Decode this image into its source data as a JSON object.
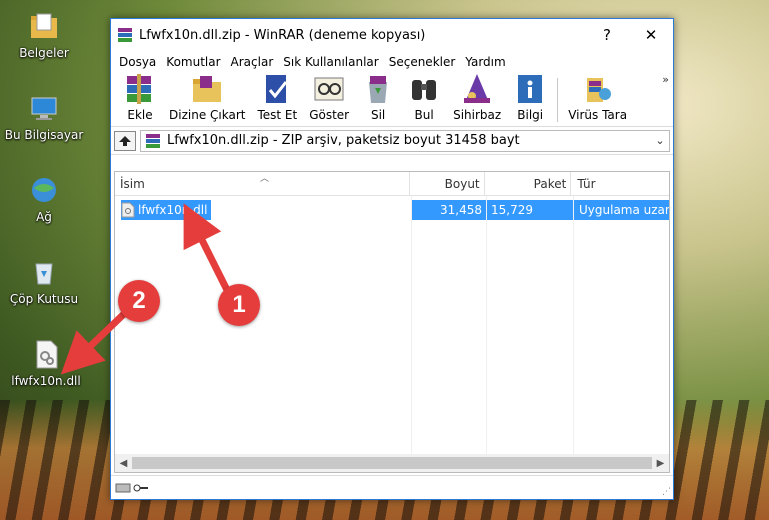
{
  "desktop": {
    "icons": [
      {
        "label": "Belgeler",
        "icon": "folder-documents-icon"
      },
      {
        "label": "Bu Bilgisayar",
        "icon": "computer-icon"
      },
      {
        "label": "Ağ",
        "icon": "network-icon"
      },
      {
        "label": "Çöp Kutusu",
        "icon": "recycle-bin-icon"
      },
      {
        "label": "lfwfx10n.dll",
        "icon": "dll-file-icon"
      }
    ]
  },
  "window": {
    "title": "Lfwfx10n.dll.zip - WinRAR (deneme kopyası)",
    "help_btn": "?",
    "close_btn": "✕"
  },
  "menu": [
    "Dosya",
    "Komutlar",
    "Araçlar",
    "Sık Kullanılanlar",
    "Seçenekler",
    "Yardım"
  ],
  "toolbar": {
    "tools": [
      {
        "label": "Ekle",
        "icon": "add-archive-icon"
      },
      {
        "label": "Dizine Çıkart",
        "icon": "extract-to-icon"
      },
      {
        "label": "Test Et",
        "icon": "test-icon"
      },
      {
        "label": "Göster",
        "icon": "view-icon"
      },
      {
        "label": "Sil",
        "icon": "delete-icon"
      },
      {
        "label": "Bul",
        "icon": "find-icon"
      },
      {
        "label": "Sihirbaz",
        "icon": "wizard-icon"
      },
      {
        "label": "Bilgi",
        "icon": "info-icon"
      },
      {
        "label": "Virüs Tara",
        "icon": "virus-scan-icon"
      }
    ],
    "more": "»"
  },
  "address": {
    "text": "Lfwfx10n.dll.zip - ZIP arşiv, paketsiz boyut 31458 bayt",
    "dropdown": "⌄"
  },
  "list": {
    "headers": {
      "name": "İsim",
      "size": "Boyut",
      "packed": "Paket",
      "type": "Tür"
    },
    "rows": [
      {
        "name": "lfwfx10n.dll",
        "size": "31,458",
        "packed": "15,729",
        "type": "Uygulama uzantısı"
      }
    ]
  },
  "annotations": {
    "badge1": "1",
    "badge2": "2"
  },
  "colors": {
    "selection": "#3399ff",
    "badge": "#e53c3c",
    "window_border": "#2b79d8"
  }
}
